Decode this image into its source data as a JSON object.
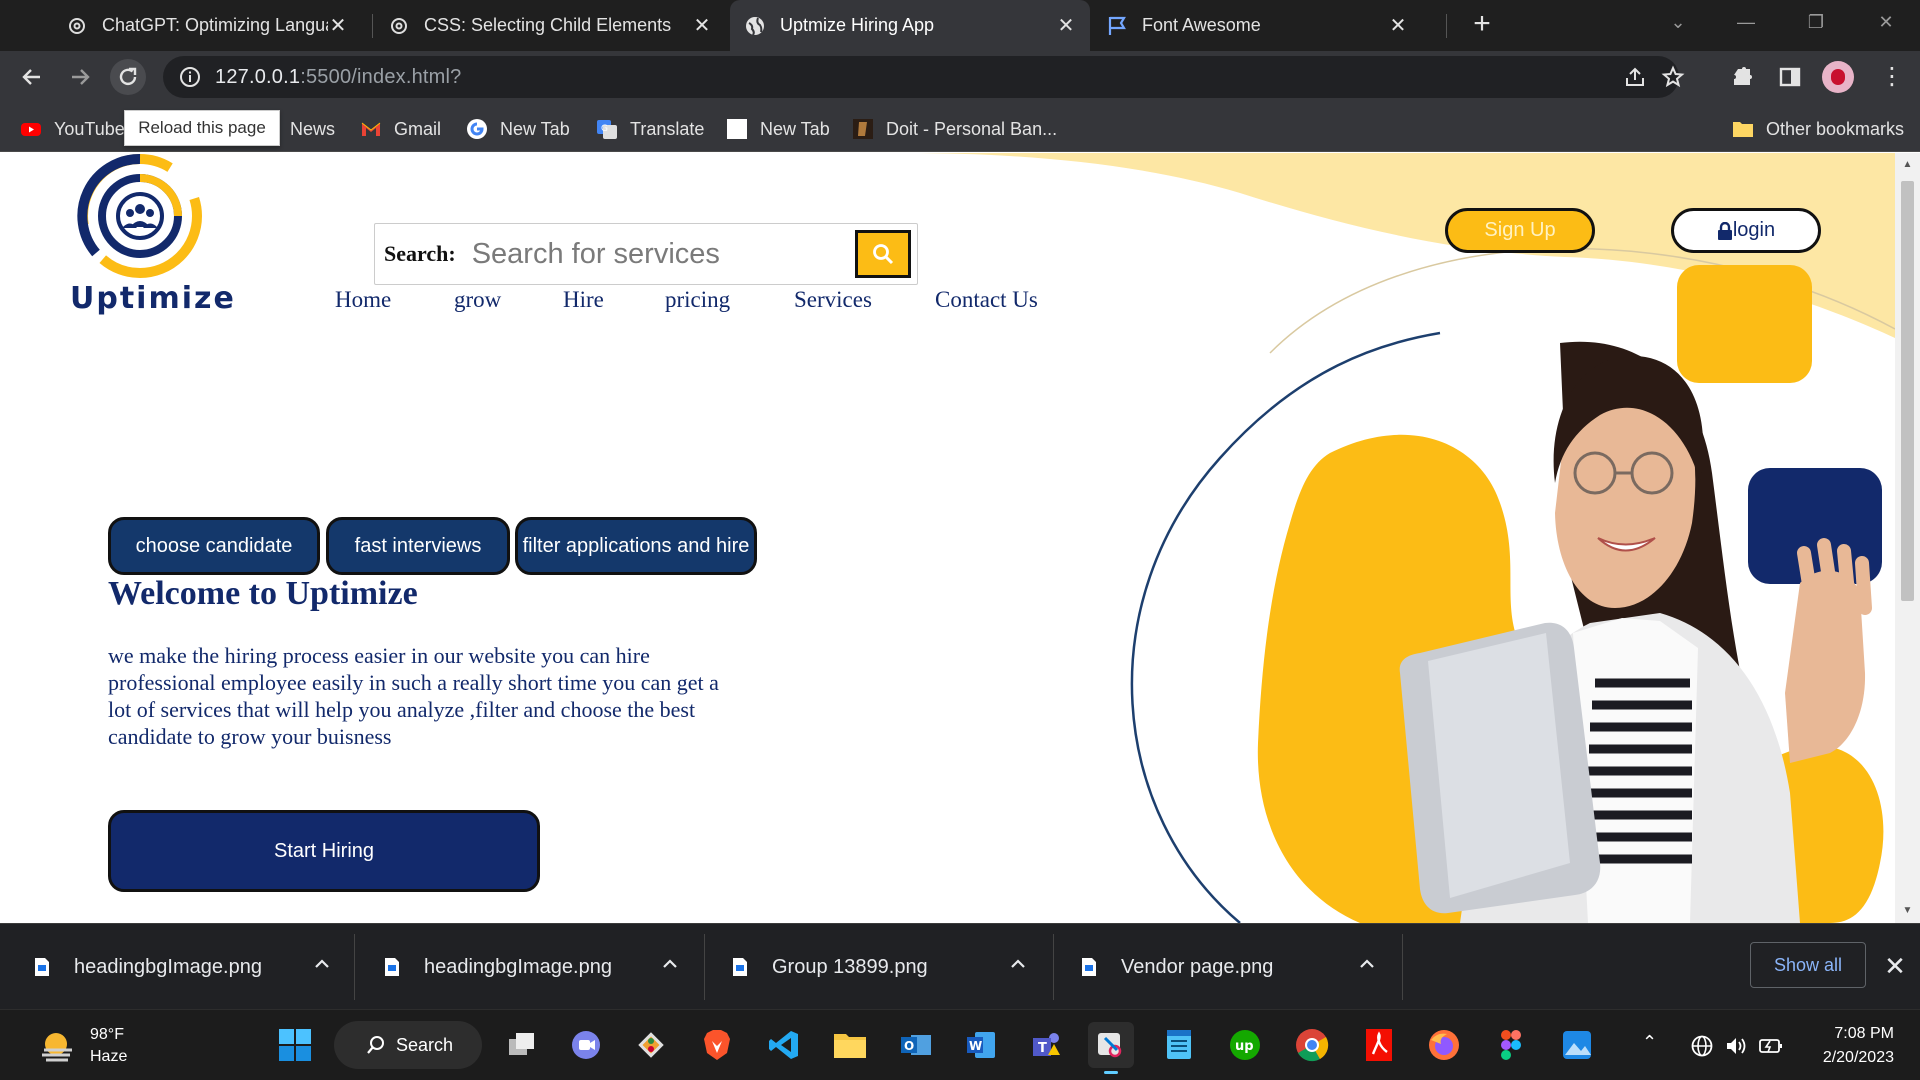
{
  "browser": {
    "tabs": [
      {
        "title": "ChatGPT: Optimizing Language M",
        "icon": "openai-icon"
      },
      {
        "title": "CSS: Selecting Child Elements",
        "icon": "openai-icon"
      },
      {
        "title": "Uptmize Hiring App",
        "icon": "globe-icon",
        "active": true
      },
      {
        "title": "Font Awesome",
        "icon": "flag-icon"
      }
    ],
    "address": {
      "host": "127.0.0.1",
      "rest": ":5500/index.html?"
    },
    "tooltip": "Reload this page",
    "bookmarks": [
      "YouTube",
      "News",
      "Gmail",
      "New Tab",
      "Translate",
      "New Tab",
      "Doit - Personal Ban..."
    ],
    "other_bookmarks": "Other bookmarks"
  },
  "page": {
    "logo_text": "Uptimize",
    "search": {
      "label": "Search:",
      "placeholder": "Search for services"
    },
    "nav": [
      "Home",
      "grow",
      "Hire",
      "pricing",
      "Services",
      "Contact Us"
    ],
    "auth": {
      "signup": "Sign Up",
      "login": "login"
    },
    "chips": [
      "choose candidate",
      "fast interviews",
      "filter applications and hire"
    ],
    "welcome": "Welcome to Uptimize",
    "description": "we make the hiring process easier in our website you can hire professional employee easily in such a really short time you can get a lot of services that will help you analyze ,filter and choose the best candidate to grow your buisness",
    "cta": "Start Hiring",
    "colors": {
      "navy": "#12296b",
      "gold": "#fcbc15",
      "cream": "#fde7a4"
    }
  },
  "downloads": {
    "files": [
      "headingbgImage.png",
      "headingbgImage.png",
      "Group 13899.png",
      "Vendor page.png"
    ],
    "show_all": "Show all"
  },
  "taskbar": {
    "weather": {
      "temp": "98°F",
      "condition": "Haze"
    },
    "search_label": "Search",
    "time": "7:08 PM",
    "date": "2/20/2023"
  }
}
